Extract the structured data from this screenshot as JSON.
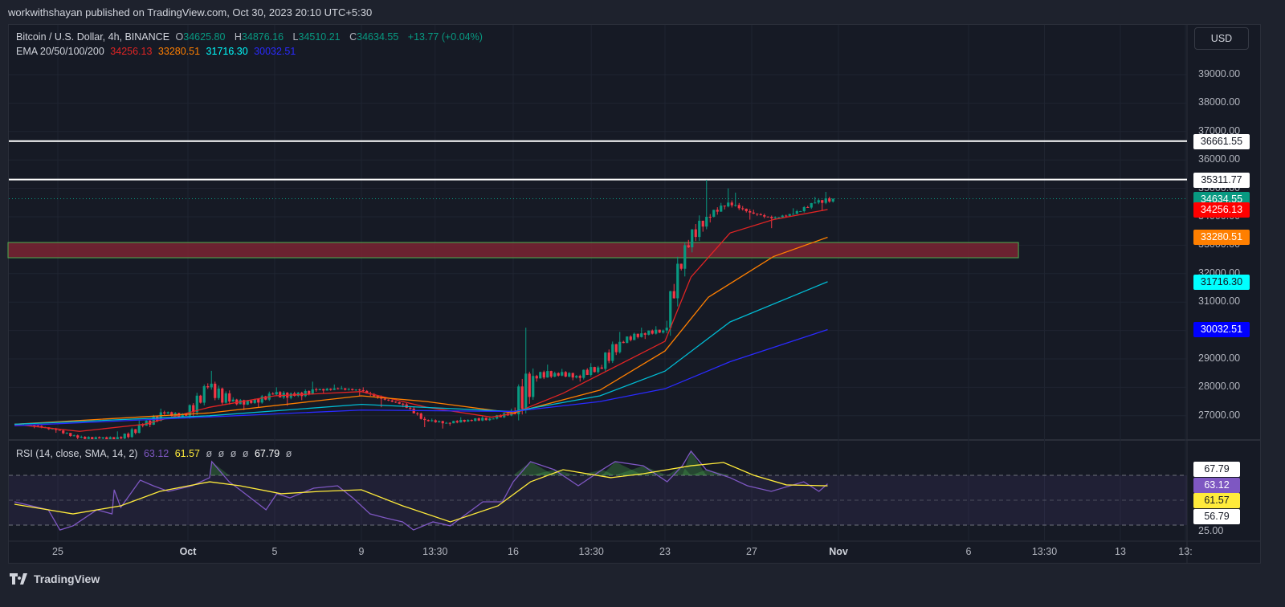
{
  "header": {
    "published": "workwithshayan published on TradingView.com, Oct 30, 2023 20:10 UTC+5:30"
  },
  "legend": {
    "symbol": "Bitcoin / U.S. Dollar, 4h, BINANCE",
    "o_label": "O",
    "o": "34625.80",
    "h_label": "H",
    "h": "34876.16",
    "l_label": "L",
    "l": "34510.21",
    "c_label": "C",
    "c": "34634.55",
    "change": "+13.77 (+0.04%)",
    "ema_title": "EMA 20/50/100/200",
    "ema20": "34256.13",
    "ema50": "33280.51",
    "ema100": "31716.30",
    "ema200": "30032.51"
  },
  "rsi_legend": {
    "title": "RSI (14, close, SMA, 14, 2)",
    "rsi": "63.12",
    "ma": "61.57",
    "empty": "ø",
    "upper": "67.79"
  },
  "price_scale": {
    "currency": "USD",
    "ticks": [
      "39000.00",
      "38000.00",
      "37000.00",
      "36000.00",
      "35000.00",
      "34000.00",
      "33000.00",
      "32000.00",
      "31000.00",
      "30000.00",
      "29000.00",
      "28000.00",
      "27000.00"
    ],
    "tags": [
      {
        "text": "36661.55",
        "bg": "#ffffff",
        "fg": "#131722"
      },
      {
        "text": "35311.77",
        "bg": "#ffffff",
        "fg": "#131722"
      },
      {
        "text": "34634.55",
        "bg": "#089981",
        "fg": "#ffffff"
      },
      {
        "text": "34256.13",
        "bg": "#ff0000",
        "fg": "#ffffff"
      },
      {
        "text": "33280.51",
        "bg": "#ff7f00",
        "fg": "#ffffff"
      },
      {
        "text": "31716.30",
        "bg": "#00ffff",
        "fg": "#131722"
      },
      {
        "text": "30032.51",
        "bg": "#0000ff",
        "fg": "#ffffff"
      }
    ]
  },
  "rsi_scale": {
    "tick": "25.00",
    "tags": [
      {
        "text": "67.79",
        "bg": "#ffffff",
        "fg": "#131722"
      },
      {
        "text": "63.12",
        "bg": "#7e57c2",
        "fg": "#ffffff"
      },
      {
        "text": "61.57",
        "bg": "#ffeb3b",
        "fg": "#131722"
      },
      {
        "text": "56.79",
        "bg": "#ffffff",
        "fg": "#131722"
      }
    ]
  },
  "time_axis": [
    {
      "label": "25",
      "day": 2
    },
    {
      "label": "Oct",
      "day": 8
    },
    {
      "label": "5",
      "day": 12
    },
    {
      "label": "9",
      "day": 16
    },
    {
      "label": "13:30",
      "day": 19.4
    },
    {
      "label": "16",
      "day": 23
    },
    {
      "label": "13:30",
      "day": 26.6
    },
    {
      "label": "23",
      "day": 30
    },
    {
      "label": "27",
      "day": 34
    },
    {
      "label": "Nov",
      "day": 38
    },
    {
      "label": "6",
      "day": 44
    },
    {
      "label": "13:30",
      "day": 47.5
    },
    {
      "label": "13",
      "day": 51
    },
    {
      "label": "13:",
      "day": 54
    }
  ],
  "brand": "TradingView",
  "chart_data": {
    "type": "candlestick",
    "title": "Bitcoin / U.S. Dollar, 4h, BINANCE",
    "x_unit": "days since Sep 23 2023",
    "ylim": [
      26000,
      39600
    ],
    "candles_per_day": 6,
    "first_open": 26700,
    "daily_close_high_low": [
      [
        26650,
        26720,
        26560
      ],
      [
        26500,
        26700,
        26400
      ],
      [
        26230,
        26500,
        26150
      ],
      [
        26200,
        26300,
        26100
      ],
      [
        26200,
        26450,
        26100
      ],
      [
        26650,
        26850,
        26200
      ],
      [
        27080,
        27250,
        26600
      ],
      [
        27000,
        27150,
        26900
      ],
      [
        28000,
        28100,
        26950
      ],
      [
        27500,
        28580,
        27400
      ],
      [
        27450,
        27650,
        27200
      ],
      [
        27750,
        27850,
        27300
      ],
      [
        27700,
        28000,
        27350
      ],
      [
        27900,
        28200,
        27550
      ],
      [
        27950,
        28100,
        27800
      ],
      [
        27900,
        28050,
        27700
      ],
      [
        27600,
        28000,
        27300
      ],
      [
        27400,
        27650,
        27300
      ],
      [
        26850,
        27450,
        26600
      ],
      [
        26750,
        26900,
        26550
      ],
      [
        26850,
        26950,
        26650
      ],
      [
        26900,
        27000,
        26800
      ],
      [
        27100,
        27250,
        26900
      ],
      [
        28400,
        30100,
        27050
      ],
      [
        28500,
        28800,
        28200
      ],
      [
        28400,
        28650,
        28250
      ],
      [
        28700,
        28850,
        28200
      ],
      [
        29600,
        29950,
        28650
      ],
      [
        29900,
        30100,
        29550
      ],
      [
        30000,
        30150,
        29700
      ],
      [
        33000,
        33100,
        29900
      ],
      [
        34000,
        35300,
        32900
      ],
      [
        34500,
        35000,
        33800
      ],
      [
        34150,
        34850,
        33900
      ],
      [
        33950,
        34250,
        33600
      ],
      [
        34100,
        34300,
        33900
      ],
      [
        34500,
        34700,
        34150
      ],
      [
        34634.55,
        34876.16,
        34200
      ]
    ],
    "last_day_candles": 5,
    "emas": [
      {
        "name": "EMA 20",
        "color": "#e02424",
        "points": [
          [
            0,
            26700
          ],
          [
            3,
            26450
          ],
          [
            6,
            26700
          ],
          [
            9,
            27300
          ],
          [
            12,
            27700
          ],
          [
            16,
            27850
          ],
          [
            19,
            27300
          ],
          [
            22,
            26950
          ],
          [
            23,
            27080
          ],
          [
            25.3,
            27790
          ],
          [
            30,
            29620
          ],
          [
            31.2,
            31880
          ],
          [
            33,
            33430
          ],
          [
            35,
            33900
          ],
          [
            37.5,
            34256.13
          ]
        ]
      },
      {
        "name": "EMA 50",
        "color": "#ff7f00",
        "points": [
          [
            0,
            26700
          ],
          [
            9,
            27100
          ],
          [
            16,
            27700
          ],
          [
            19,
            27500
          ],
          [
            23,
            27100
          ],
          [
            27,
            27900
          ],
          [
            30,
            29280
          ],
          [
            32,
            31170
          ],
          [
            35,
            32600
          ],
          [
            37.5,
            33280.51
          ]
        ]
      },
      {
        "name": "EMA 100",
        "color": "#00bcd4",
        "points": [
          [
            0,
            26700
          ],
          [
            9,
            27000
          ],
          [
            16,
            27400
          ],
          [
            23,
            27150
          ],
          [
            27,
            27700
          ],
          [
            30,
            28570
          ],
          [
            33,
            30300
          ],
          [
            37.5,
            31716.3
          ]
        ]
      },
      {
        "name": "EMA 200",
        "color": "#2a2aff",
        "points": [
          [
            0,
            26650
          ],
          [
            16,
            27200
          ],
          [
            23,
            27150
          ],
          [
            27,
            27500
          ],
          [
            30,
            27950
          ],
          [
            33,
            28900
          ],
          [
            37.5,
            30032.51
          ]
        ]
      }
    ],
    "horizontal_lines": [
      36661.55,
      35311.77
    ],
    "zone": {
      "top": 33096,
      "bottom": 32559,
      "from_day": 0,
      "to_day": 46.3,
      "fill": "#7a2533"
    },
    "last_price": 34634.55,
    "rsi": {
      "ylim": [
        0,
        100
      ],
      "bands": [
        70,
        50,
        30
      ],
      "values": [
        [
          0,
          48.7
        ],
        [
          1.56,
          42.3
        ],
        [
          2.1,
          26.1
        ],
        [
          2.7,
          29.4
        ],
        [
          3.8,
          42.3
        ],
        [
          4.5,
          39
        ],
        [
          4.6,
          58.4
        ],
        [
          4.9,
          44.2
        ],
        [
          5.8,
          66.1
        ],
        [
          6.4,
          61.6
        ],
        [
          7.1,
          57.1
        ],
        [
          8.2,
          61.6
        ],
        [
          9,
          68.1
        ],
        [
          9.1,
          81
        ],
        [
          9.9,
          64.8
        ],
        [
          10.4,
          58.4
        ],
        [
          11.6,
          42.3
        ],
        [
          12.1,
          55.2
        ],
        [
          12.7,
          51.9
        ],
        [
          13.8,
          59.7
        ],
        [
          14.9,
          61.6
        ],
        [
          15.6,
          51.9
        ],
        [
          16.4,
          39
        ],
        [
          17.1,
          35.8
        ],
        [
          17.9,
          32.6
        ],
        [
          18.4,
          26.1
        ],
        [
          19.3,
          32.6
        ],
        [
          20.1,
          29.4
        ],
        [
          21.6,
          48.7
        ],
        [
          22.5,
          48.7
        ],
        [
          23,
          64.8
        ],
        [
          23.8,
          81
        ],
        [
          24.9,
          74.5
        ],
        [
          26,
          61.6
        ],
        [
          27.1,
          74.5
        ],
        [
          27.7,
          81
        ],
        [
          29,
          77.7
        ],
        [
          30.1,
          64.8
        ],
        [
          30.8,
          77.7
        ],
        [
          31.2,
          89.4
        ],
        [
          31.9,
          74.5
        ],
        [
          33,
          68.1
        ],
        [
          33.8,
          61.6
        ],
        [
          34.9,
          57.1
        ],
        [
          36.4,
          64.8
        ],
        [
          37.1,
          57.1
        ],
        [
          37.5,
          63.12
        ]
      ],
      "ma": [
        [
          0,
          46.8
        ],
        [
          2.7,
          39
        ],
        [
          4.9,
          45.5
        ],
        [
          6.7,
          57.1
        ],
        [
          9,
          64.8
        ],
        [
          10.4,
          61.6
        ],
        [
          12.3,
          55.2
        ],
        [
          14.1,
          57.1
        ],
        [
          16,
          58.4
        ],
        [
          17.9,
          45.5
        ],
        [
          20.1,
          32.6
        ],
        [
          22.3,
          45.5
        ],
        [
          23.8,
          64.8
        ],
        [
          25.3,
          74.5
        ],
        [
          27.5,
          68.1
        ],
        [
          29,
          71.3
        ],
        [
          31.2,
          77.7
        ],
        [
          32.7,
          80.3
        ],
        [
          34.1,
          70
        ],
        [
          35.6,
          62.3
        ],
        [
          37.5,
          61.57
        ]
      ]
    }
  }
}
